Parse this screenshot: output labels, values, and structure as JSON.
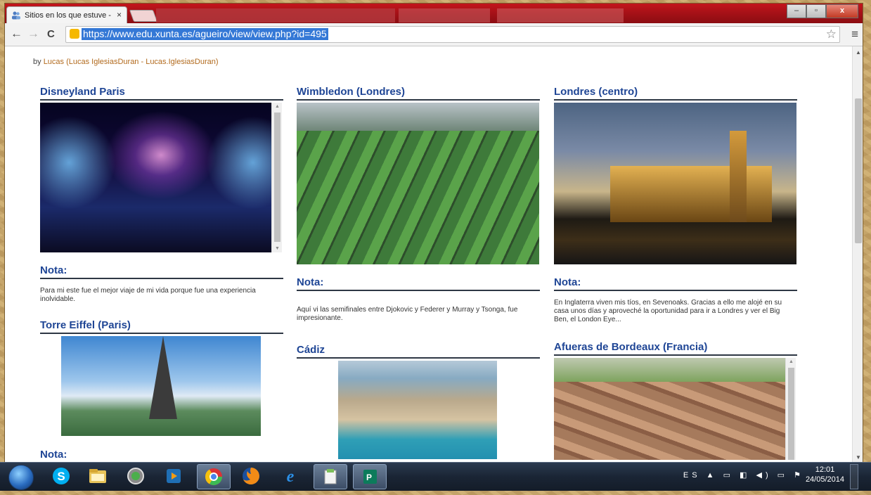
{
  "browser": {
    "tab_title": "Sitios en los que estuve - ",
    "tab_close": "×",
    "url": "https://www.edu.xunta.es/agueiro/view/view.php?id=495",
    "back": "←",
    "forward": "→",
    "reload": "C",
    "bookmark_star": "☆",
    "menu": "≡",
    "minimize": "–",
    "maximize": "▫",
    "close": "x"
  },
  "page": {
    "byline_prefix": "by",
    "byline_author": "Lucas (Lucas IglesiasDuran - Lucas.IglesiasDuran)",
    "col1": {
      "title1": "Disneyland Paris",
      "note_title1": "Nota:",
      "note_text1": " Para mi este fue el mejor viaje de mi vida porque fue una experiencia inolvidable.",
      "title2": "Torre Eiffel (Paris)",
      "note_title2": "Nota:"
    },
    "col2": {
      "title1": "Wimbledon (Londres)",
      "note_title1": "Nota:",
      "note_text1": "Aquí vi las semifinales entre Djokovic y Federer y Murray y Tsonga, fue impresionante.",
      "title2": "Cádiz"
    },
    "col3": {
      "title1": "Londres (centro)",
      "note_title1": "Nota:",
      "note_text1": "En Inglaterra viven mis tíos, en Sevenoaks. Gracias a ello me alojé en su casa unos días y aproveché la oportunidad para ir a Londres y ver el Big Ben, el London Eye...",
      "title2": "Afueras de Bordeaux (Francia)"
    }
  },
  "taskbar": {
    "items": [
      "skype-icon",
      "explorer-icon",
      "media-center-icon",
      "media-player-icon",
      "chrome-icon",
      "firefox-icon",
      "ie-icon",
      "notes-icon",
      "publisher-icon"
    ],
    "lang": "ES",
    "time": "12:01",
    "date": "24/05/2014"
  },
  "colors": {
    "heading": "#1e4595",
    "link": "#b26a1d",
    "titlebar": "#c3151c"
  }
}
